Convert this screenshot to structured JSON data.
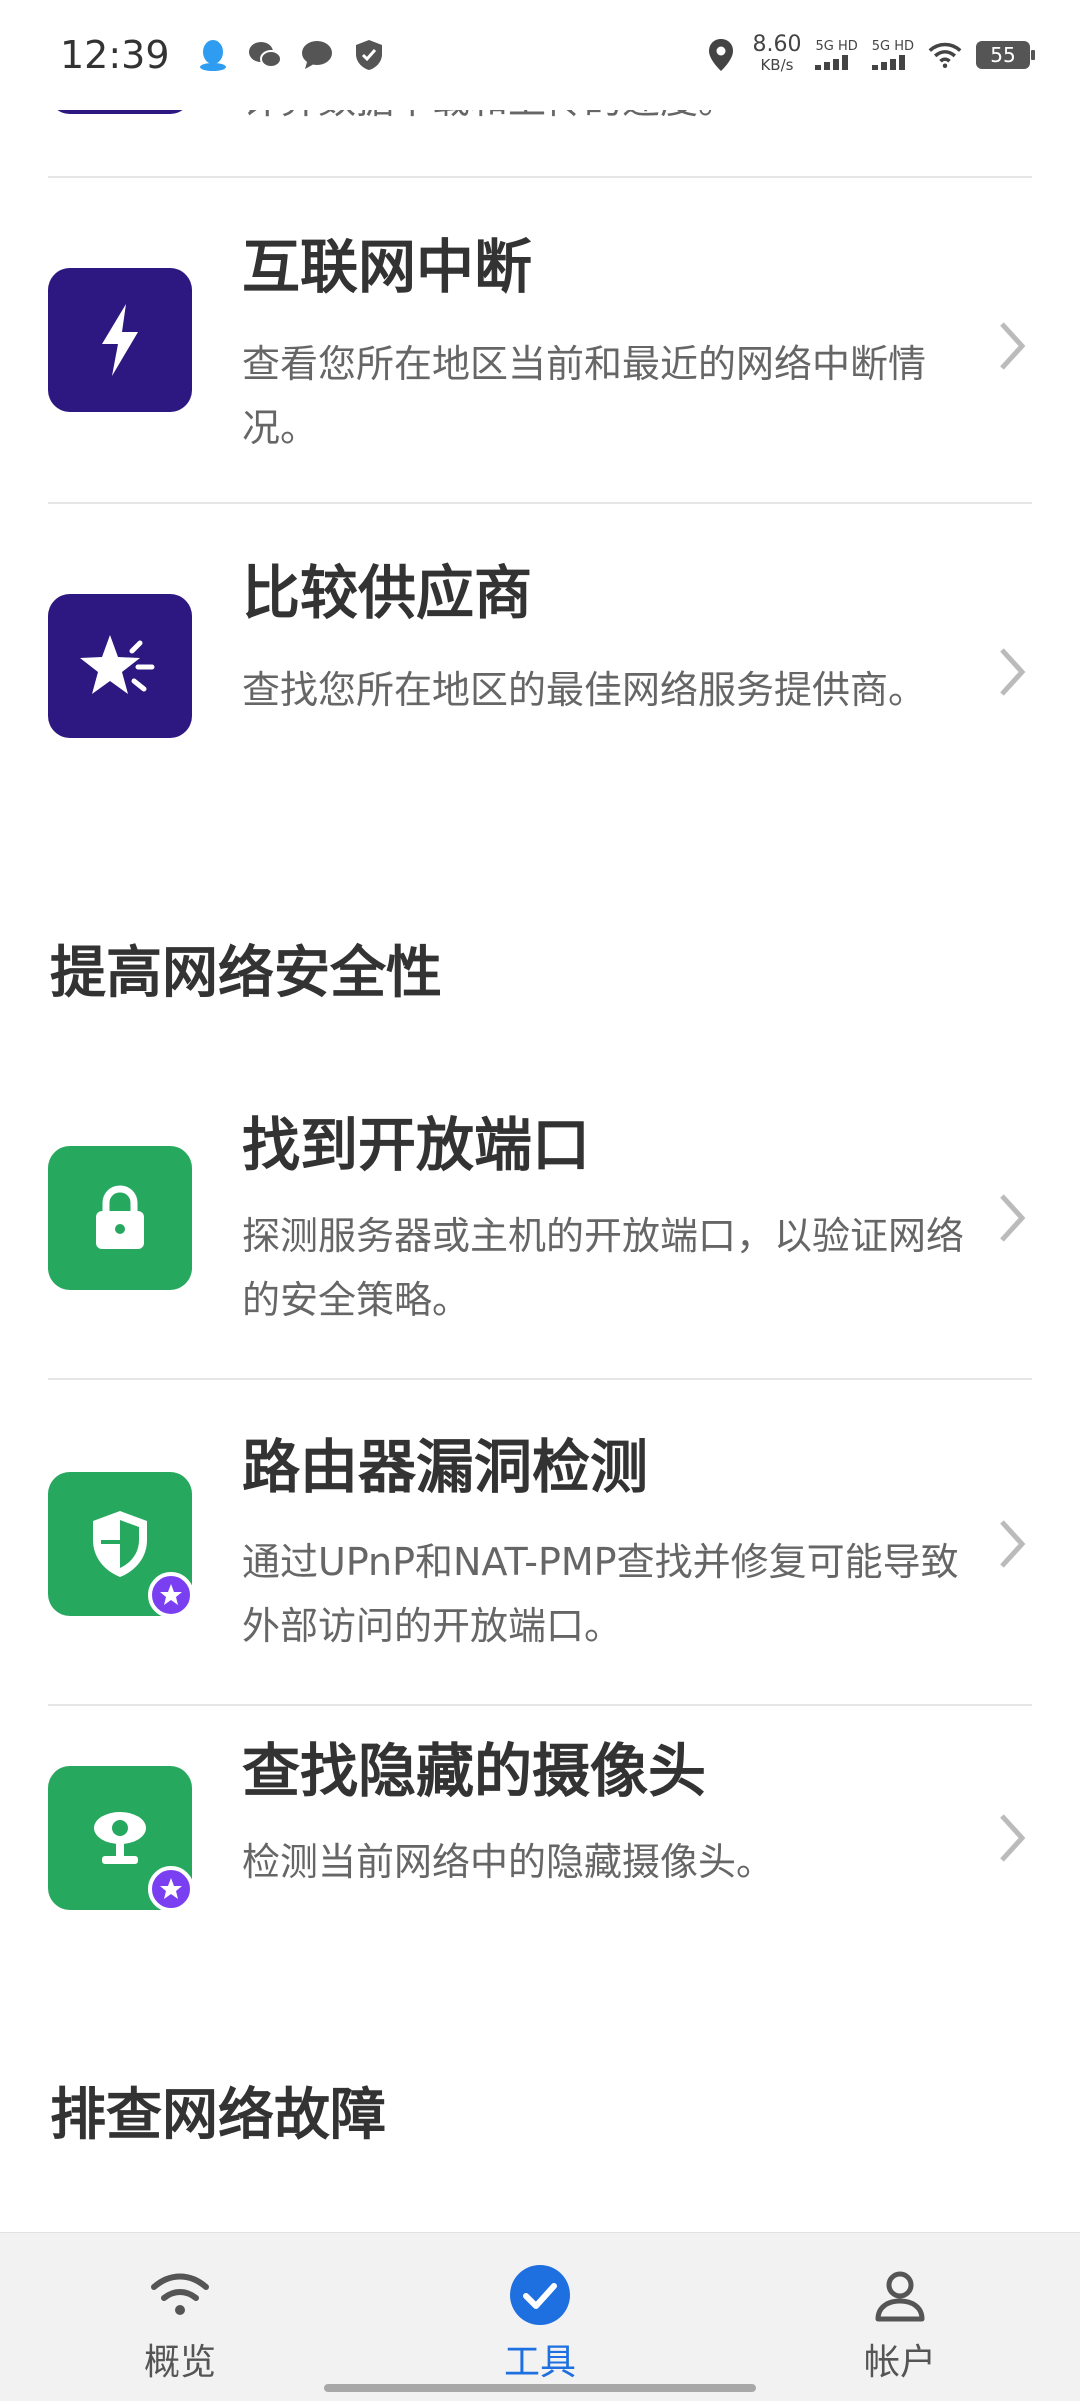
{
  "status_bar": {
    "time": "12:39",
    "speed_value": "8.60",
    "speed_unit": "KB/s",
    "sim1_label": "5G HD",
    "sim2_label": "5G HD",
    "battery": "55"
  },
  "top_partial": {
    "desc": "计算数据下载和上传的速度。"
  },
  "items": [
    {
      "title": "互联网中断",
      "desc": "查看您所在地区当前和最近的网络中断情况。",
      "icon": "lightning-icon",
      "color": "#2d1780"
    },
    {
      "title": "比较供应商",
      "desc": "查找您所在地区的最佳网络服务提供商。",
      "icon": "star-compare-icon",
      "color": "#2d1780"
    }
  ],
  "sections": {
    "security": "提高网络安全性",
    "troubleshoot": "排查网络故障"
  },
  "security_items": [
    {
      "title": "找到开放端口",
      "desc": "探测服务器或主机的开放端口，以验证网络的安全策略。",
      "icon": "lock-icon",
      "color": "#27a85f"
    },
    {
      "title": "路由器漏洞检测",
      "desc": "通过UPnP和NAT-PMP查找并修复可能导致外部访问的开放端口。",
      "icon": "shield-icon",
      "color": "#27a85f"
    },
    {
      "title": "查找隐藏的摄像头",
      "desc": "检测当前网络中的隐藏摄像头。",
      "icon": "camera-icon",
      "color": "#27a85f"
    }
  ],
  "bottom_nav": {
    "overview": "概览",
    "tools": "工具",
    "account": "帐户",
    "active_color": "#1e6fe0"
  }
}
